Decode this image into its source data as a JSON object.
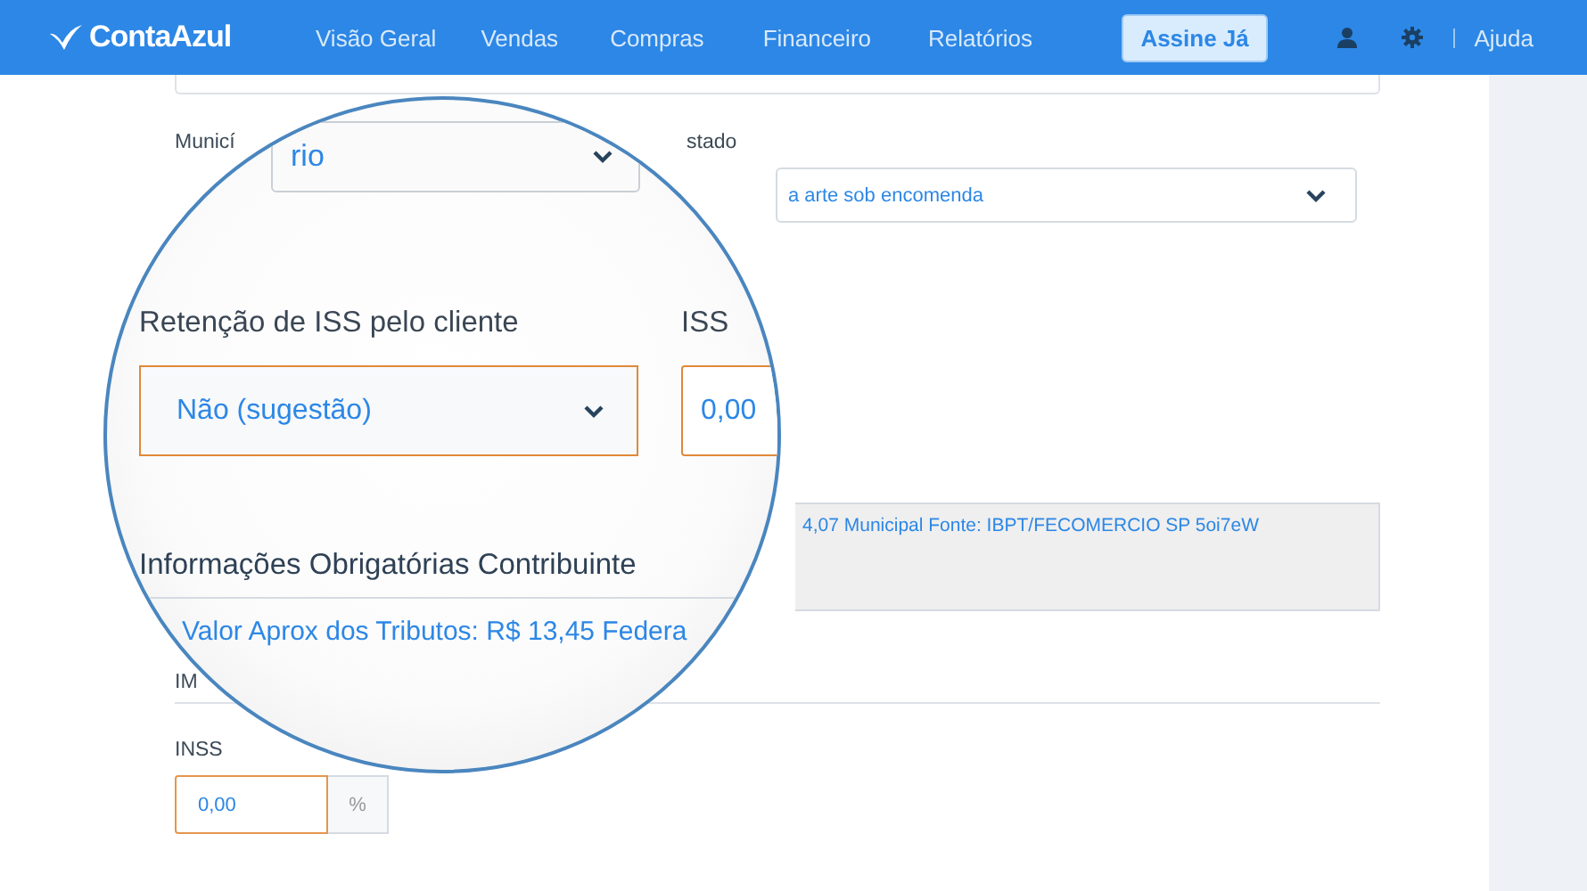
{
  "nav": {
    "logo": "ContaAzul",
    "items": [
      {
        "label": "Visão Geral"
      },
      {
        "label": "Vendas"
      },
      {
        "label": "Compras"
      },
      {
        "label": "Financeiro"
      },
      {
        "label": "Relatórios"
      }
    ],
    "cta": "Assine Já",
    "help": "Ajuda"
  },
  "form": {
    "municipio_label": "Municí",
    "estado_label": "stado",
    "estado_value": "a arte sob encomenda",
    "tributos_note": "4,07 Municipal Fonte: IBPT/FECOMERCIO SP 5oi7eW",
    "section_label": "IM",
    "inss": {
      "label": "INSS",
      "value": "0,00",
      "unit": "%"
    }
  },
  "magnifier": {
    "municipio_value": "rio",
    "retencao": {
      "label": "Retenção de ISS pelo cliente",
      "value": "Não (sugestão)"
    },
    "iss": {
      "label": "ISS",
      "value": "0,00"
    },
    "section_title": "Informações Obrigatórias Contribuinte",
    "tributos_note": "Valor Aprox dos Tributos: R$ 13,45 Federa"
  }
}
